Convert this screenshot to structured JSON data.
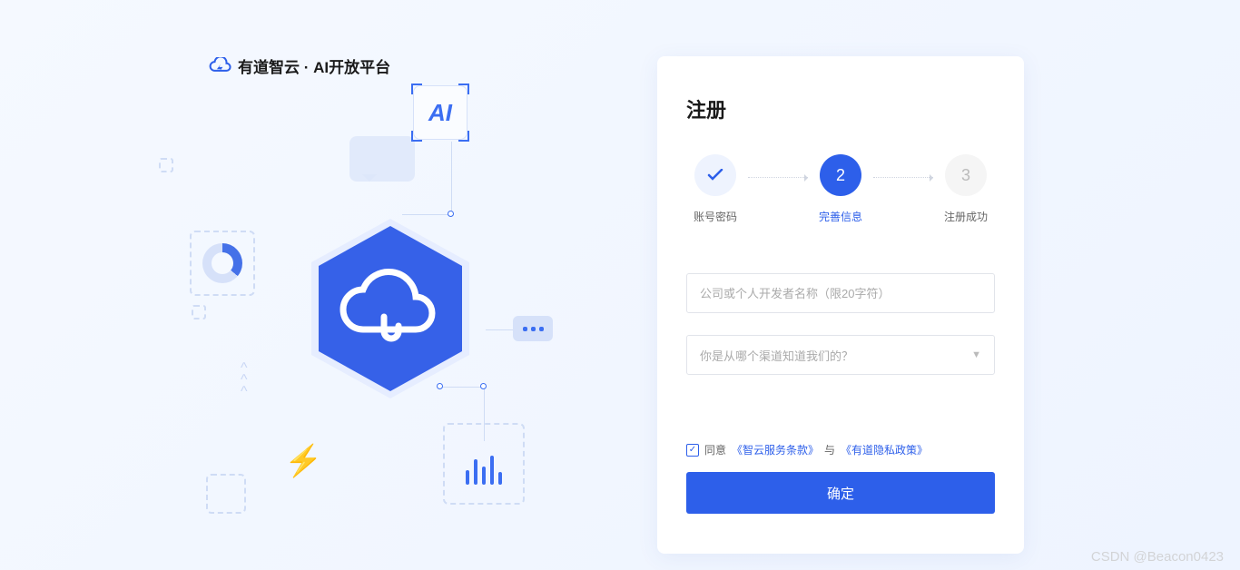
{
  "logo": {
    "text": "有道智云 · AI开放平台"
  },
  "illustration": {
    "ai_label": "AI"
  },
  "card": {
    "title": "注册",
    "steps": [
      {
        "label": "账号密码",
        "state": "done"
      },
      {
        "label": "完善信息",
        "state": "current",
        "num": "2"
      },
      {
        "label": "注册成功",
        "state": "pending",
        "num": "3"
      }
    ],
    "name_input": {
      "placeholder": "公司或个人开发者名称（限20字符）",
      "value": ""
    },
    "channel_select": {
      "placeholder": "你是从哪个渠道知道我们的？"
    },
    "agreement": {
      "checked": true,
      "prefix": "同意",
      "tos": "《智云服务条款》",
      "mid": "与",
      "privacy": "《有道隐私政策》"
    },
    "submit_label": "确定"
  },
  "watermark": "CSDN @Beacon0423"
}
